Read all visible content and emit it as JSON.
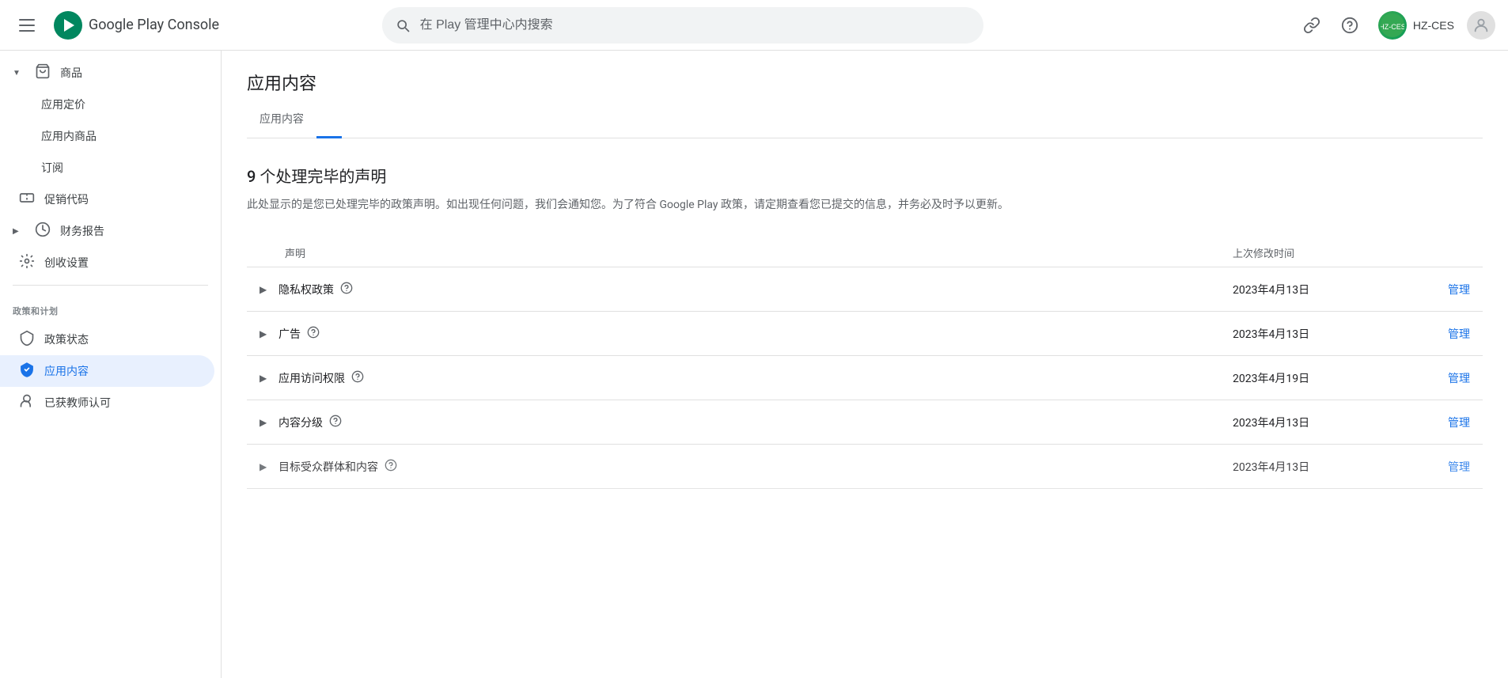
{
  "app": {
    "title": "Google Play Console"
  },
  "header": {
    "menu_icon": "≡",
    "search_placeholder": "在 Play 管理中心内搜索",
    "link_icon": "🔗",
    "help_icon": "?",
    "account_name": "HZ-CES"
  },
  "sidebar": {
    "sections": [
      {
        "items": [
          {
            "id": "goods",
            "label": "商品",
            "icon": "🛒",
            "has_expand": true,
            "active": false,
            "children": [
              {
                "id": "app-pricing",
                "label": "应用定价",
                "active": false
              },
              {
                "id": "app-products",
                "label": "应用内商品",
                "active": false
              },
              {
                "id": "subscriptions",
                "label": "订阅",
                "active": false
              }
            ]
          },
          {
            "id": "promo-codes",
            "label": "促销代码",
            "icon": "🏷",
            "has_expand": false,
            "active": false
          },
          {
            "id": "financial-report",
            "label": "财务报告",
            "icon": "💰",
            "has_expand": true,
            "active": false
          },
          {
            "id": "monetization-settings",
            "label": "创收设置",
            "icon": "⚙",
            "has_expand": false,
            "active": false
          }
        ]
      },
      {
        "label": "政策和计划",
        "items": [
          {
            "id": "policy-status",
            "label": "政策状态",
            "icon": "shield",
            "active": false
          },
          {
            "id": "app-content",
            "label": "应用内容",
            "icon": "shield-blue",
            "active": true
          },
          {
            "id": "teacher-approved",
            "label": "已获教师认可",
            "icon": "badge",
            "active": false
          }
        ]
      }
    ]
  },
  "content": {
    "page_title": "应用内容",
    "tabs": [
      {
        "id": "tab1",
        "label": "应用内容",
        "active": false
      },
      {
        "id": "tab2",
        "label": "",
        "active": true
      }
    ],
    "section_title": "9 个处理完毕的声明",
    "section_desc": "此处显示的是您已处理完毕的政策声明。如出现任何问题，我们会通知您。为了符合 Google Play 政策，请定期查看您已提交的信息，并务必及时予以更新。",
    "table": {
      "col_declaration": "声明",
      "col_modified": "上次修改时间",
      "col_action": "",
      "rows": [
        {
          "id": "privacy-policy",
          "name": "隐私权政策",
          "has_help": true,
          "modified": "2023年4月13日",
          "action": "管理"
        },
        {
          "id": "ads",
          "name": "广告",
          "has_help": true,
          "modified": "2023年4月13日",
          "action": "管理"
        },
        {
          "id": "app-access",
          "name": "应用访问权限",
          "has_help": true,
          "modified": "2023年4月19日",
          "action": "管理"
        },
        {
          "id": "content-rating",
          "name": "内容分级",
          "has_help": true,
          "modified": "2023年4月13日",
          "action": "管理"
        },
        {
          "id": "target-audience",
          "name": "目标受众群体和内容",
          "has_help": true,
          "modified": "2023年4月13日",
          "action": "管理"
        }
      ]
    }
  }
}
